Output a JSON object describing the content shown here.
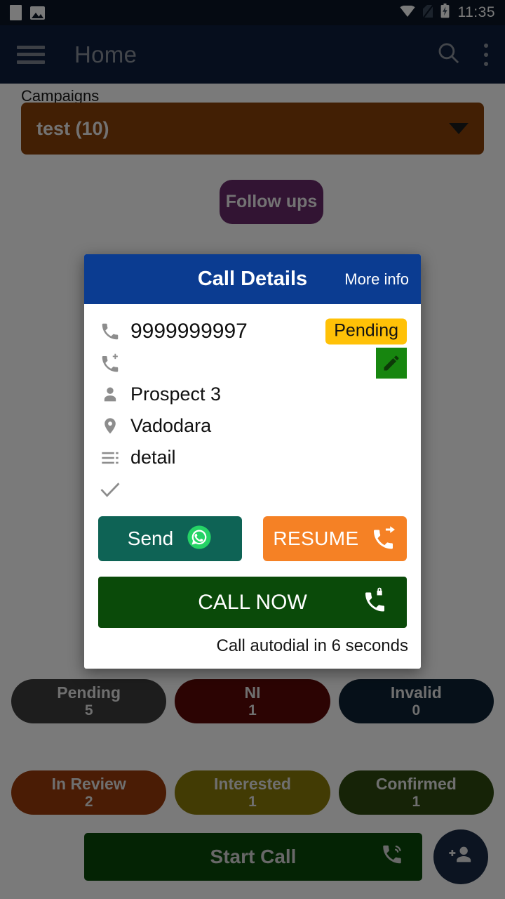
{
  "status_bar": {
    "time": "11:35",
    "icons": [
      "document-icon",
      "image-icon",
      "wifi-icon",
      "no-sim-icon",
      "battery-charging-icon"
    ]
  },
  "app_bar": {
    "menu_icon": "hamburger-menu-icon",
    "title": "Home",
    "search_icon": "search-icon",
    "overflow_icon": "overflow-menu-icon"
  },
  "page": {
    "campaigns_label": "Campaigns",
    "campaign_selected": "test (10)",
    "dropdown_icon": "chevron-down-icon",
    "followups_label": "Follow ups",
    "status_chips": [
      {
        "label": "Pending",
        "count": "5",
        "color": "#3d3d3d"
      },
      {
        "label": "NI",
        "count": "1",
        "color": "#5c0a08"
      },
      {
        "label": "Invalid",
        "count": "0",
        "color": "#0d2236"
      },
      {
        "label": "In Review",
        "count": "2",
        "color": "#9c3b0c"
      },
      {
        "label": "Interested",
        "count": "1",
        "color": "#8a7c0a"
      },
      {
        "label": "Confirmed",
        "count": "1",
        "color": "#2f4a10"
      }
    ],
    "start_call_label": "Start Call",
    "start_call_icon": "phone-ringing-icon",
    "fab_icon": "add-person-icon"
  },
  "dialog": {
    "title": "Call Details",
    "more_info_label": "More info",
    "rows": [
      {
        "icon": "phone-icon",
        "text": "9999999997"
      },
      {
        "icon": "add-call-icon",
        "text": ""
      },
      {
        "icon": "person-icon",
        "text": "Prospect 3"
      },
      {
        "icon": "location-pin-icon",
        "text": "Vadodara"
      },
      {
        "icon": "notes-list-icon",
        "text": "detail"
      },
      {
        "icon": "check-icon",
        "text": ""
      }
    ],
    "status_badge": "Pending",
    "status_badge_color": "#ffc107",
    "edit_icon": "edit-pencil-icon",
    "send_label": "Send",
    "send_icon": "whatsapp-icon",
    "resume_label": "RESUME",
    "resume_icon": "call-forward-icon",
    "call_now_label": "CALL NOW",
    "call_now_icon": "phone-lock-icon",
    "autodial_text": "Call autodial in 6 seconds"
  }
}
